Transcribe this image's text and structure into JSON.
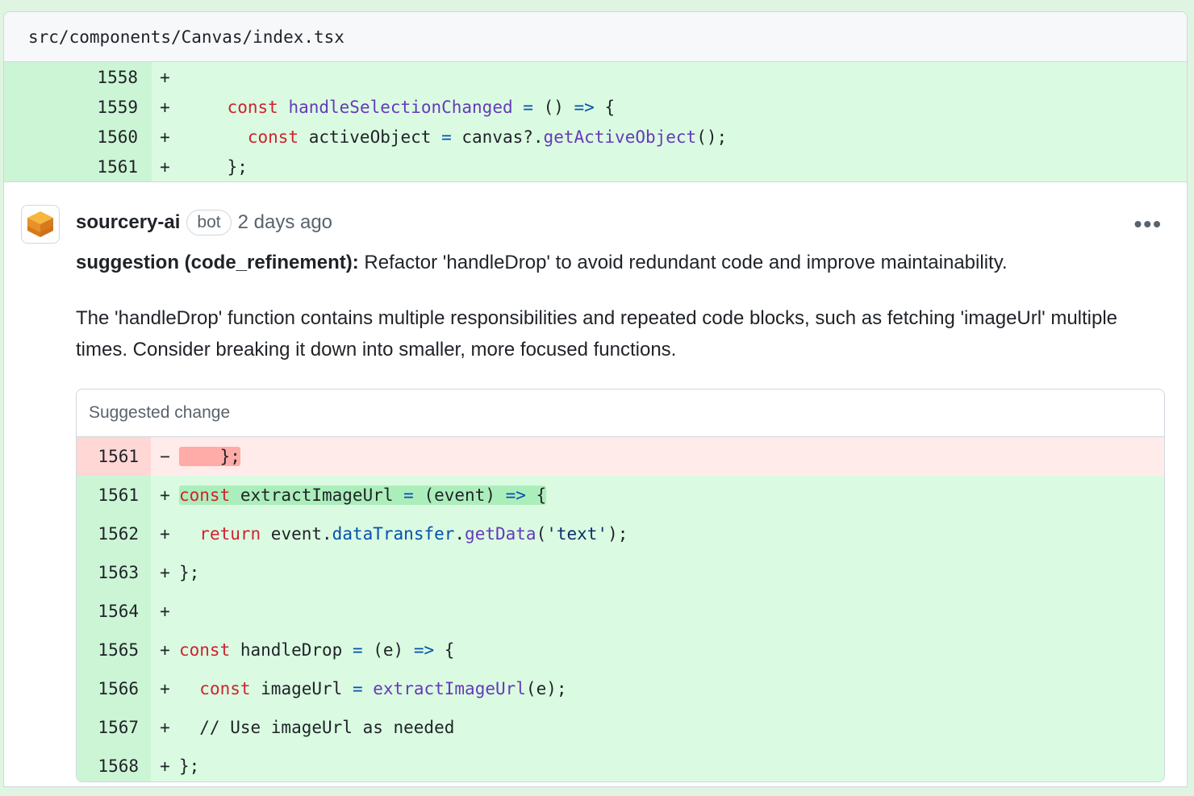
{
  "file": {
    "path": "src/components/Canvas/index.tsx",
    "lines": [
      {
        "num": "1558",
        "sign": "+",
        "code": ""
      },
      {
        "num": "1559",
        "sign": "+",
        "code": "    const handleSelectionChanged = () => {"
      },
      {
        "num": "1560",
        "sign": "+",
        "code": "      const activeObject = canvas?.getActiveObject();"
      },
      {
        "num": "1561",
        "sign": "+",
        "code": "    };"
      }
    ]
  },
  "comment": {
    "author": "sourcery-ai",
    "badge": "bot",
    "time": "2 days ago",
    "more": "•••",
    "suggestion_label": "suggestion (code_refinement):",
    "suggestion_text": " Refactor 'handleDrop' to avoid redundant code and improve maintainability.",
    "body": "The 'handleDrop' function contains multiple responsibilities and repeated code blocks, such as fetching 'imageUrl' multiple times. Consider breaking it down into smaller, more focused functions."
  },
  "suggested_change": {
    "title": "Suggested change",
    "rows": [
      {
        "num": "1561",
        "sign": "−",
        "type": "del",
        "code": "    };"
      },
      {
        "num": "1561",
        "sign": "+",
        "type": "add",
        "code": "const extractImageUrl = (event) => {"
      },
      {
        "num": "1562",
        "sign": "+",
        "type": "add",
        "code": "  return event.dataTransfer.getData('text');"
      },
      {
        "num": "1563",
        "sign": "+",
        "type": "add",
        "code": "};"
      },
      {
        "num": "1564",
        "sign": "+",
        "type": "add",
        "code": ""
      },
      {
        "num": "1565",
        "sign": "+",
        "type": "add",
        "code": "const handleDrop = (e) => {"
      },
      {
        "num": "1566",
        "sign": "+",
        "type": "add",
        "code": "  const imageUrl = extractImageUrl(e);"
      },
      {
        "num": "1567",
        "sign": "+",
        "type": "add",
        "code": "  // Use imageUrl as needed"
      },
      {
        "num": "1568",
        "sign": "+",
        "type": "add",
        "code": "};"
      }
    ]
  },
  "colors": {
    "add_bg": "#dafbe1",
    "del_bg": "#ffebe9",
    "keyword": "#cf222e",
    "function": "#6639ba"
  }
}
